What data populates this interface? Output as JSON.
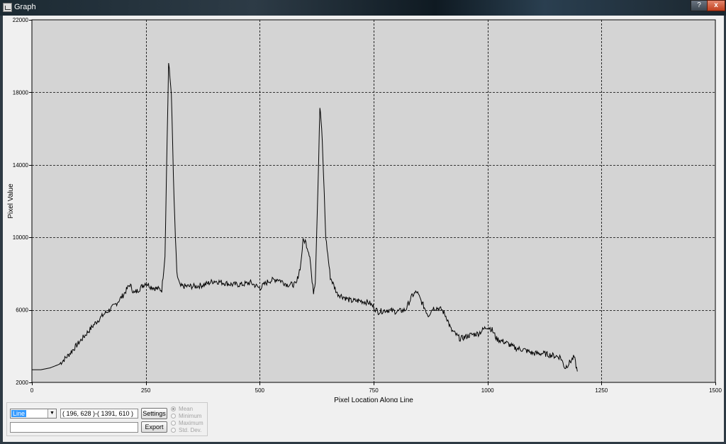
{
  "window": {
    "title": "Graph",
    "help_label": "?",
    "close_label": "x"
  },
  "chart_data": {
    "type": "line",
    "xlabel": "Pixel Location Along Line",
    "ylabel": "Pixel Value",
    "xlim": [
      0,
      1500
    ],
    "ylim": [
      2000,
      22000
    ],
    "xticks": [
      0,
      250,
      500,
      750,
      1000,
      1250,
      1500
    ],
    "yticks": [
      2000,
      6000,
      10000,
      14000,
      18000,
      22000
    ],
    "grid": true,
    "colors": {
      "plot_bg": "#d4d4d4",
      "line": "#000000",
      "grid": "#000000"
    },
    "series": [
      {
        "x": [
          0,
          20,
          40,
          60,
          80,
          100,
          120,
          140,
          160,
          180,
          200,
          215,
          225,
          250,
          260,
          270,
          285,
          292,
          300,
          306,
          312,
          318,
          325,
          340,
          360,
          380,
          400,
          420,
          440,
          460,
          480,
          500,
          520,
          540,
          560,
          580,
          590,
          595,
          600,
          610,
          615,
          618,
          622,
          628,
          632,
          636,
          640,
          645,
          655,
          670,
          700,
          720,
          740,
          760,
          780,
          800,
          820,
          835,
          845,
          850,
          860,
          870,
          880,
          890,
          900,
          910,
          920,
          940,
          950,
          960,
          980,
          1000,
          1010,
          1020,
          1040,
          1060,
          1080,
          1100,
          1120,
          1140,
          1160,
          1170,
          1180,
          1190,
          1197
        ],
        "y": [
          2700,
          2700,
          2800,
          3000,
          3500,
          4100,
          4700,
          5300,
          5800,
          6200,
          6800,
          7400,
          6900,
          7500,
          7300,
          7200,
          7100,
          9000,
          19600,
          18000,
          12000,
          8000,
          7300,
          7300,
          7300,
          7400,
          7600,
          7500,
          7400,
          7400,
          7500,
          7200,
          7600,
          7700,
          7400,
          7400,
          8500,
          9800,
          9800,
          9000,
          7500,
          7000,
          7600,
          13000,
          17200,
          16000,
          13500,
          10000,
          7800,
          6900,
          6500,
          6500,
          6400,
          5900,
          6000,
          5900,
          6000,
          6800,
          7000,
          6700,
          6200,
          5700,
          6100,
          6100,
          6000,
          5600,
          4900,
          4400,
          4500,
          4600,
          4700,
          5100,
          4900,
          4400,
          4200,
          3900,
          3800,
          3600,
          3600,
          3500,
          3400,
          2800,
          3100,
          3400,
          2600
        ]
      }
    ]
  },
  "controls": {
    "mode_value": "Line",
    "dropdown_arrow": "▼",
    "coords_text": "( 196, 628 )-( 1391, 610 )",
    "field2_value": "",
    "settings_label": "Settings",
    "export_label": "Export",
    "stats_options": [
      {
        "label": "Mean",
        "selected": true
      },
      {
        "label": "Minimum",
        "selected": false
      },
      {
        "label": "Maximum",
        "selected": false
      },
      {
        "label": "Std. Dev.",
        "selected": false
      }
    ]
  }
}
